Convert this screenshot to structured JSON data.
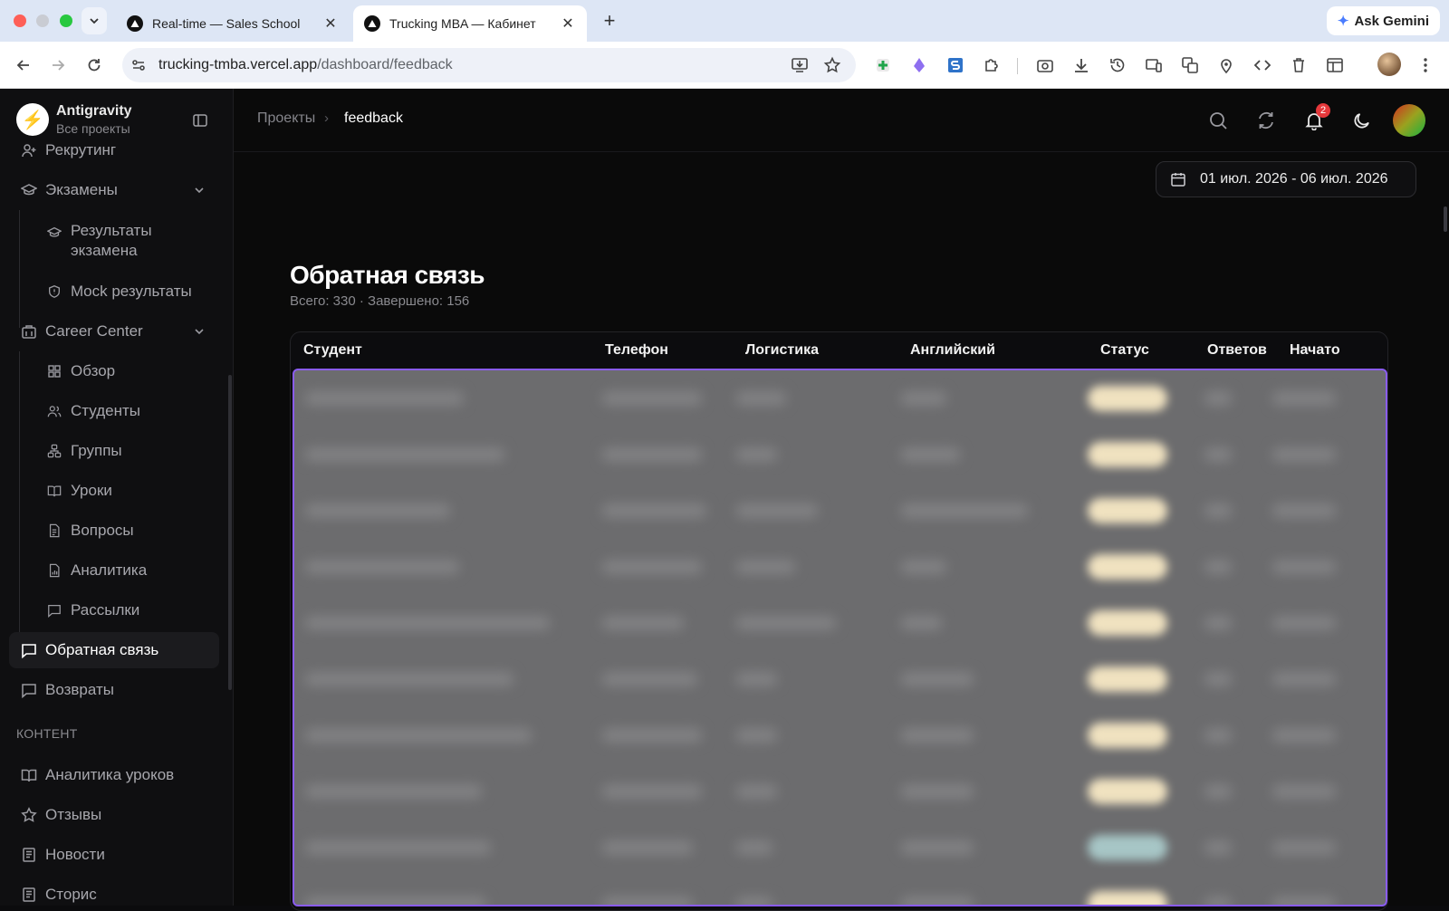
{
  "browser": {
    "tabs": [
      {
        "title": "Real-time — Sales School",
        "active": false
      },
      {
        "title": "Trucking MBA — Кабинет",
        "active": true
      }
    ],
    "new_tab_label": "+",
    "close_glyph": "✕",
    "gemini_label": "Ask Gemini",
    "url_host": "trucking-tmba.vercel.app",
    "url_path": "/dashboard/feedback"
  },
  "sidebar": {
    "brand_name": "Antigravity",
    "brand_sub": "Все проекты",
    "items": {
      "recruiting": "Рекрутинг",
      "exams": "Экзамены",
      "exam_results": "Результаты экзамена",
      "mock_results": "Mock результаты",
      "career_center": "Career Center",
      "overview": "Обзор",
      "students": "Студенты",
      "groups": "Группы",
      "lessons": "Уроки",
      "questions": "Вопросы",
      "analytics": "Аналитика",
      "mailings": "Рассылки",
      "feedback": "Обратная связь",
      "refunds": "Возвраты",
      "lesson_analytics": "Аналитика уроков",
      "reviews": "Отзывы",
      "news": "Новости",
      "stories": "Сторис"
    },
    "section_content": "КОНТЕНТ"
  },
  "topbar": {
    "breadcrumb_root": "Проекты",
    "breadcrumb_sep": "›",
    "breadcrumb_current": "feedback",
    "notification_count": "2"
  },
  "date_range": "01 июл. 2026 - 06 июл. 2026",
  "page": {
    "title": "Обратная связь",
    "subtitle": "Всего: 330 · Завершено: 156"
  },
  "table": {
    "columns": [
      "Студент",
      "Телефон",
      "Логистика",
      "Английский",
      "Статус",
      "Ответов",
      "Начато"
    ],
    "rows_obscured": true
  },
  "colors": {
    "accent_selection": "#8a5cf0",
    "status_pill": "#f0e2c0",
    "status_pill_alt": "#a7c6c6",
    "badge": "#e5383b"
  }
}
